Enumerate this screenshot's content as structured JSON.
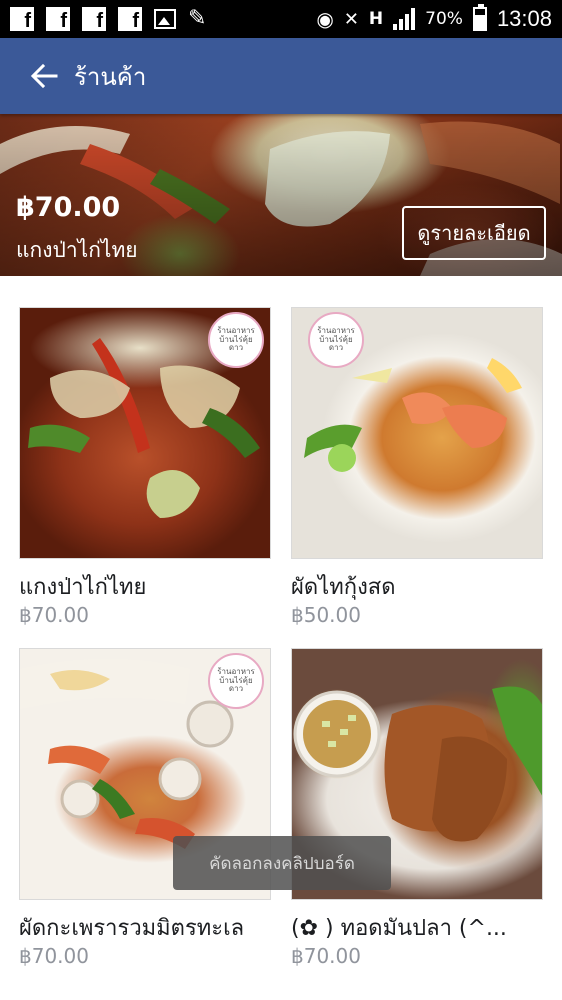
{
  "status_bar": {
    "battery": "70%",
    "battery_level": 0.7,
    "time": "13:08",
    "network": "H"
  },
  "app_bar": {
    "title": "ร้านค้า",
    "back_icon": "arrow-left-icon"
  },
  "featured": {
    "price": "฿70.00",
    "name": "แกงป่าไก่ไทย",
    "details_button": "ดูรายละเอียด"
  },
  "products": [
    {
      "name": "แกงป่าไก่ไทย",
      "price": "฿70.00",
      "logo_text": "ร้านอาหาร บ้านไร่คุ้ยดาว"
    },
    {
      "name": "ผัดไทกุ้งสด",
      "price": "฿50.00",
      "logo_text": "ร้านอาหาร บ้านไร่คุ้ยดาว"
    },
    {
      "name": "ผัดกะเพรารวมมิตรทะเล",
      "price": "฿70.00",
      "logo_text": "ร้านอาหาร บ้านไร่คุ้ยดาว"
    },
    {
      "name": "(✿ ) ทอดมันปลา (^...",
      "price": "฿70.00",
      "logo_text": ""
    }
  ],
  "toast": "คัดลอกลงคลิปบอร์ด"
}
